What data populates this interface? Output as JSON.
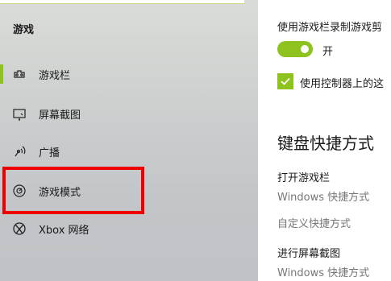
{
  "sidebar": {
    "section_title": "游戏",
    "items": [
      {
        "label": "游戏栏",
        "icon": "game-bar-icon",
        "selected": true
      },
      {
        "label": "屏幕截图",
        "icon": "capture-icon",
        "selected": false
      },
      {
        "label": "广播",
        "icon": "broadcast-icon",
        "selected": false
      },
      {
        "label": "游戏模式",
        "icon": "game-mode-icon",
        "selected": false
      },
      {
        "label": "Xbox 网络",
        "icon": "xbox-icon",
        "selected": false
      }
    ]
  },
  "content": {
    "record_setting_label": "使用游戏栏录制游戏剪",
    "toggle_state_label": "开",
    "controller_checkbox_label": "使用控制器上的这",
    "keyboard_heading": "键盘快捷方式",
    "shortcuts": [
      {
        "title": "打开游戏栏",
        "value": "Windows 快捷方式",
        "custom": "自定义快捷方式"
      },
      {
        "title": "进行屏幕截图",
        "value": "Windows 快捷方式"
      }
    ]
  },
  "colors": {
    "accent": "#8dc21f",
    "highlight_border": "#ee0000"
  }
}
